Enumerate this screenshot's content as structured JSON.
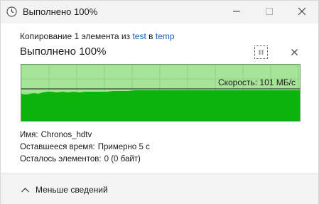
{
  "window": {
    "title": "Выполнено 100%"
  },
  "copy": {
    "prefix": "Копирование 1 элемента из ",
    "source": "test",
    "middle": " в ",
    "destination": "temp"
  },
  "progress": {
    "title": "Выполнено 100%",
    "percent": 100,
    "speed_label": "Скорость: 101 МБ/с"
  },
  "details": {
    "name_label": "Имя:",
    "name_value": "Chronos_hdtv",
    "time_label": "Оставшееся время:",
    "time_value": "Примерно 5 с",
    "items_label": "Осталось элементов:",
    "items_value": "0 (0 байт)"
  },
  "footer": {
    "less_label": "Меньше сведений"
  },
  "colors": {
    "graph_bg": "#a6e49a",
    "graph_fill": "#0bb30b",
    "graph_grid": "#8fd483",
    "link": "#1a5fb4"
  },
  "icons": {
    "window": "clock-icon",
    "minimize": "minimize-icon",
    "maximize": "maximize-icon",
    "close": "close-icon",
    "pause": "pause-icon",
    "cancel": "cancel-icon",
    "collapse": "chevron-up-icon"
  }
}
